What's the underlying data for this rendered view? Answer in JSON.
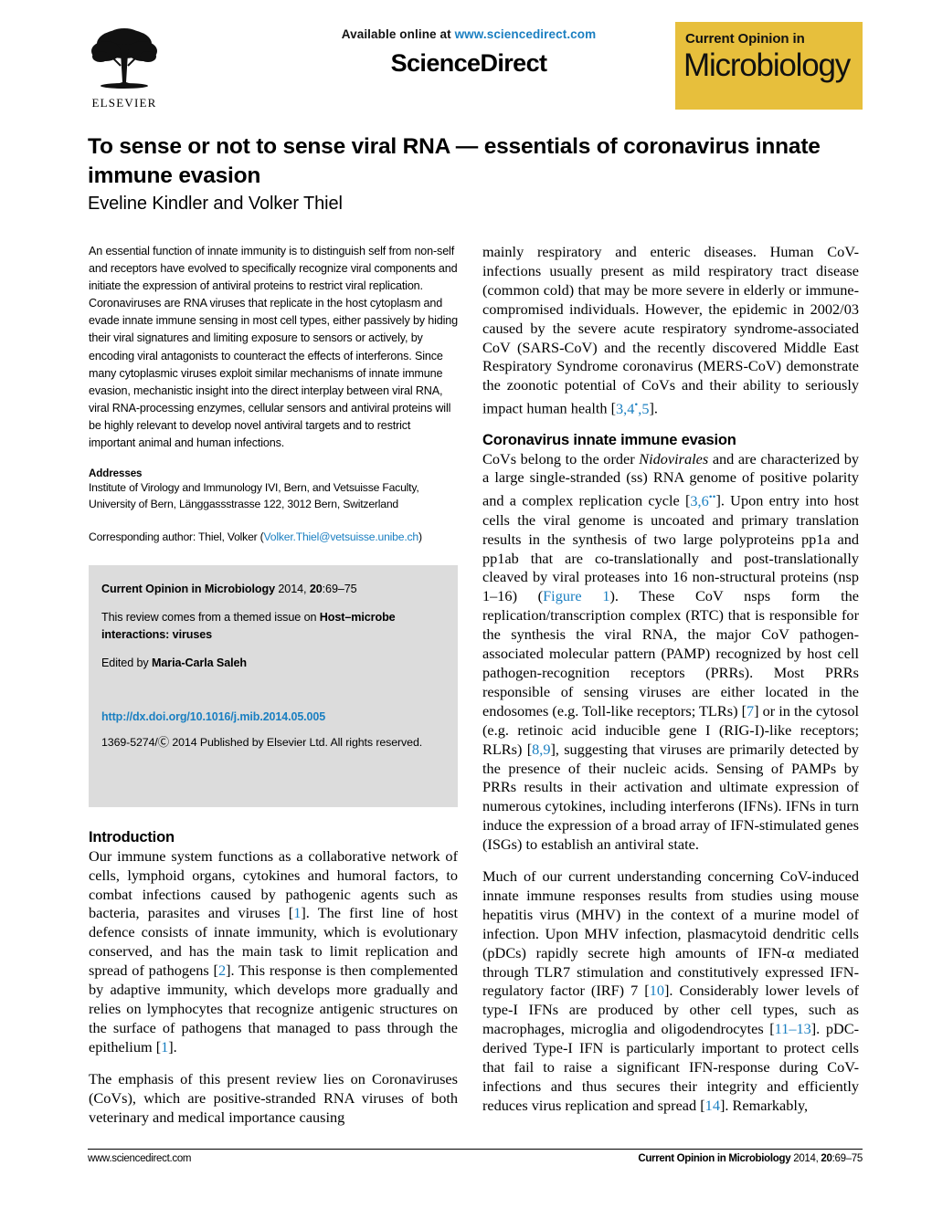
{
  "masthead": {
    "available_prefix": "Available online at ",
    "available_url": "www.sciencedirect.com",
    "sciencedirect_wordmark": "ScienceDirect",
    "elsevier_name": "ELSEVIER",
    "elsevier_icon": "elsevier-tree-icon",
    "journal_logo": {
      "line1": "Current Opinion in",
      "line2": "Microbiology",
      "background_color": "#e7bf3c"
    }
  },
  "article": {
    "title": "To sense or not to sense viral RNA — essentials of coronavirus innate immune evasion",
    "authors": "Eveline Kindler and Volker Thiel"
  },
  "abstract": {
    "text": "An essential function of innate immunity is to distinguish self from non-self and receptors have evolved to specifically recognize viral components and initiate the expression of antiviral proteins to restrict viral replication. Coronaviruses are RNA viruses that replicate in the host cytoplasm and evade innate immune sensing in most cell types, either passively by hiding their viral signatures and limiting exposure to sensors or actively, by encoding viral antagonists to counteract the effects of interferons. Since many cytoplasmic viruses exploit similar mechanisms of innate immune evasion, mechanistic insight into the direct interplay between viral RNA, viral RNA-processing enzymes, cellular sensors and antiviral proteins will be highly relevant to develop novel antiviral targets and to restrict important animal and human infections."
  },
  "addresses": {
    "heading": "Addresses",
    "body": "Institute of Virology and Immunology IVI, Bern, and Vetsuisse Faculty, University of Bern, Länggassstrasse 122, 3012 Bern, Switzerland",
    "corresponding_prefix": "Corresponding author: Thiel, Volker (",
    "corresponding_email": "Volker.Thiel@vetsuisse.unibe.ch",
    "corresponding_suffix": ")"
  },
  "infobox": {
    "citation_bold": "Current Opinion in Microbiology",
    "citation_rest": " 2014, ",
    "citation_volume": "20",
    "citation_pages": ":69–75",
    "themed_prefix": "This review comes from a themed issue on ",
    "themed_bold": "Host–microbe interactions: viruses",
    "edited_prefix": "Edited by ",
    "edited_bold": "Maria-Carla Saleh",
    "doi": "http://dx.doi.org/10.1016/j.mib.2014.05.005",
    "copyright": "1369-5274/Ⓒ 2014 Published by Elsevier Ltd. All rights reserved."
  },
  "left_column": {
    "intro_heading": "Introduction",
    "intro_p1_a": "Our immune system functions as a collaborative network of cells, lymphoid organs, cytokines and humoral factors, to combat infections caused by pathogenic agents such as bacteria, parasites and viruses [",
    "intro_p1_ref1": "1",
    "intro_p1_b": "]. The first line of host defence consists of innate immunity, which is evolutionary conserved, and has the main task to limit replication and spread of pathogens [",
    "intro_p1_ref2": "2",
    "intro_p1_c": "]. This response is then complemented by adaptive immunity, which develops more gradually and relies on lymphocytes that recognize antigenic structures on the surface of pathogens that managed to pass through the epithelium [",
    "intro_p1_ref3": "1",
    "intro_p1_d": "].",
    "intro_p2": "The emphasis of this present review lies on Coronaviruses (CoVs), which are positive-stranded RNA viruses of both veterinary and medical importance causing"
  },
  "right_column": {
    "cont_p_a": "mainly respiratory and enteric diseases. Human CoV-infections usually present as mild respiratory tract disease (common cold) that may be more severe in elderly or immune-compromised individuals. However, the epidemic in 2002/03 caused by the severe acute respiratory syndrome-associated CoV (SARS-CoV) and the recently discovered Middle East Respiratory Syndrome coronavirus (MERS-CoV) demonstrate the zoonotic potential of CoVs and their ability to seriously impact human health [",
    "cont_p_ref": "3,4",
    "cont_p_refstar": "•",
    "cont_p_ref2": ",5",
    "cont_p_b": "].",
    "section_heading": "Coronavirus innate immune evasion",
    "p1_a": "CoVs belong to the order ",
    "p1_italic": "Nidovirales",
    "p1_b": " and are characterized by a large single-stranded (ss) RNA genome of positive polarity and a complex replication cycle [",
    "p1_ref1": "3,6",
    "p1_ref1star": "••",
    "p1_c": "]. Upon entry into host cells the viral genome is uncoated and primary translation results in the synthesis of two large polyproteins pp1a and pp1ab that are co-translationally and post-translationally cleaved by viral proteases into 16 non-structural proteins (nsp 1–16) (",
    "p1_figref": "Figure 1",
    "p1_d": "). These CoV nsps form the replication/transcription complex (RTC) that is responsible for the synthesis the viral RNA, the major CoV pathogen-associated molecular pattern (PAMP) recognized by host cell pathogen-recognition receptors (PRRs). Most PRRs responsible of sensing viruses are either located in the endosomes (e.g. Toll-like receptors; TLRs) [",
    "p1_ref2": "7",
    "p1_e": "] or in the cytosol (e.g. retinoic acid inducible gene I (RIG-I)-like receptors; RLRs) [",
    "p1_ref3": "8,9",
    "p1_f": "], suggesting that viruses are primarily detected by the presence of their nucleic acids. Sensing of PAMPs by PRRs results in their activation and ultimate expression of numerous cytokines, including interferons (IFNs). IFNs in turn induce the expression of a broad array of IFN-stimulated genes (ISGs) to establish an antiviral state.",
    "p2_a": "Much of our current understanding concerning CoV-induced innate immune responses results from studies using mouse hepatitis virus (MHV) in the context of a murine model of infection. Upon MHV infection, plasmacytoid dendritic cells (pDCs) rapidly secrete high amounts of IFN-α mediated through TLR7 stimulation and constitutively expressed IFN-regulatory factor (IRF) 7 [",
    "p2_ref1": "10",
    "p2_b": "]. Considerably lower levels of type-I IFNs are produced by other cell types, such as macrophages, microglia and oligodendrocytes [",
    "p2_ref2": "11–13",
    "p2_c": "]. pDC-derived Type-I IFN is particularly important to protect cells that fail to raise a significant IFN-response during CoV-infections and thus secures their integrity and efficiently reduces virus replication and spread [",
    "p2_ref3": "14",
    "p2_d": "]. Remarkably,"
  },
  "footer": {
    "left": "www.sciencedirect.com",
    "right_bold": "Current Opinion in Microbiology",
    "right_normal": " 2014, ",
    "right_volume": "20",
    "right_pages": ":69–75"
  },
  "colors": {
    "link": "#1a7fc1",
    "journal_gold": "#e7bf3c",
    "infobox_gray": "#dcdcdc"
  }
}
